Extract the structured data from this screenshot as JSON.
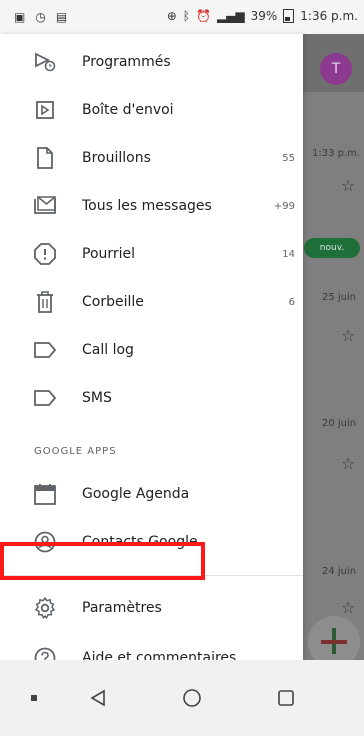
{
  "status_bar": {
    "battery_percent": "39%",
    "time": "1:36 p.m."
  },
  "drawer": {
    "items": [
      {
        "label": "Programmés",
        "count": ""
      },
      {
        "label": "Boîte d'envoi",
        "count": ""
      },
      {
        "label": "Brouillons",
        "count": "55"
      },
      {
        "label": "Tous les messages",
        "count": "+99"
      },
      {
        "label": "Pourriel",
        "count": "14"
      },
      {
        "label": "Corbeille",
        "count": "6"
      },
      {
        "label": "Call log",
        "count": ""
      },
      {
        "label": "SMS",
        "count": ""
      }
    ],
    "section_header": "GOOGLE APPS",
    "apps": [
      {
        "label": "Google Agenda"
      },
      {
        "label": "Contacts Google"
      }
    ],
    "footer": [
      {
        "label": "Paramètres"
      },
      {
        "label": "Aide et commentaires"
      }
    ]
  },
  "background": {
    "avatar_letter": "T",
    "time1": "1:33 p.m.",
    "badge": "nouv.",
    "date1": "25 juin",
    "date2": "20 juin",
    "date3": "24 juin"
  },
  "colors": {
    "highlight": "#ff1a1a",
    "avatar": "#8b3a8f"
  }
}
